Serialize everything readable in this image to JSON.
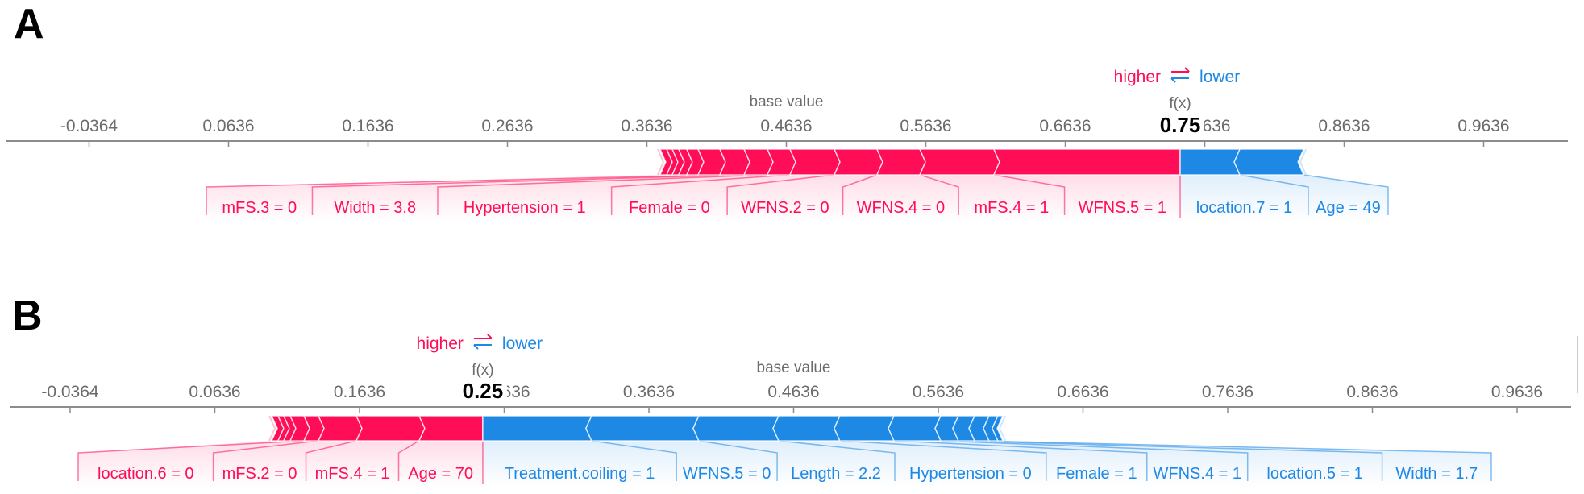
{
  "figure": {
    "colors": {
      "positive": "#ff0d57",
      "negative": "#1e88e5",
      "positive_light": "#ffc3d5",
      "negative_light": "#d1e6fa",
      "axis": "#8c8c8c",
      "text_gray": "#6b6b6b"
    }
  },
  "chart_data": [
    {
      "type": "bar",
      "subtype": "shap-force-plot",
      "panel_label": "A",
      "legend": {
        "higher": "higher",
        "lower": "lower",
        "arrow_glyph": "⇄",
        "placement": "top-right, above f(x)"
      },
      "base_value_label": "base value",
      "fx_label": "f(x)",
      "fx_value_text": "0.75",
      "fx_value": 0.746,
      "base_value": 0.4636,
      "xlim": [
        -0.085,
        1.077
      ],
      "ticks": [
        -0.0364,
        0.0636,
        0.1636,
        0.2636,
        0.3636,
        0.4636,
        0.5636,
        0.6636,
        0.7636,
        0.8636,
        0.9636
      ],
      "tick_labels": [
        "-0.0364",
        "0.0636",
        "0.1636",
        "0.2636",
        "0.3636",
        "0.4636",
        "0.5636",
        "0.6636",
        "0.7636",
        "0.8636",
        "0.9636"
      ],
      "positive_segments": [
        {
          "label": "WFNS.5 = 1",
          "start": 0.6124,
          "end": 0.746
        },
        {
          "label": "mFS.4 = 1",
          "start": 0.5593,
          "end": 0.6124
        },
        {
          "label": "WFNS.4 = 0",
          "start": 0.5286,
          "end": 0.5593
        },
        {
          "label": "WFNS.2 = 0",
          "start": 0.498,
          "end": 0.5286
        },
        {
          "label": "Female = 0",
          "start": 0.4662,
          "end": 0.498
        },
        {
          "label": "Hypertension = 1",
          "start": 0.45,
          "end": 0.4662
        },
        {
          "label": "Width = 3.8",
          "start": 0.4333,
          "end": 0.45
        },
        {
          "label": "mFS.3 = 0",
          "start": 0.4159,
          "end": 0.4333
        },
        {
          "label": "",
          "start": 0.4003,
          "end": 0.4159
        },
        {
          "label": "",
          "start": 0.3922,
          "end": 0.4003
        },
        {
          "label": "",
          "start": 0.3864,
          "end": 0.3922
        },
        {
          "label": "",
          "start": 0.3818,
          "end": 0.3864
        },
        {
          "label": "",
          "start": 0.3778,
          "end": 0.3818
        },
        {
          "label": "",
          "start": 0.3731,
          "end": 0.3778
        }
      ],
      "negative_segments": [
        {
          "label": "location.7 = 1",
          "start": 0.746,
          "end": 0.7888
        },
        {
          "label": "Age = 49",
          "start": 0.7888,
          "end": 0.8345
        }
      ]
    },
    {
      "type": "bar",
      "subtype": "shap-force-plot",
      "panel_label": "B",
      "legend": {
        "higher": "higher",
        "lower": "lower",
        "arrow_glyph": "⇄",
        "placement": "top, above f(x)"
      },
      "base_value_label": "base value",
      "fx_label": "f(x)",
      "fx_value_text": "0.25",
      "fx_value": 0.2488,
      "base_value": 0.4636,
      "xlim": [
        -0.085,
        1.0
      ],
      "ticks": [
        -0.0364,
        0.0636,
        0.1636,
        0.2636,
        0.3636,
        0.4636,
        0.5636,
        0.6636,
        0.7636,
        0.8636,
        0.9636
      ],
      "tick_labels": [
        "-0.0364",
        "0.0636",
        "0.1636",
        "0.2636",
        "0.3636",
        "0.4636",
        "0.5636",
        "0.6636",
        "0.7636",
        "0.8636",
        "0.9636"
      ],
      "positive_segments": [
        {
          "label": "Age = 70",
          "start": 0.2048,
          "end": 0.2488
        },
        {
          "label": "mFS.4 = 1",
          "start": 0.1614,
          "end": 0.2048
        },
        {
          "label": "mFS.2 = 0",
          "start": 0.1352,
          "end": 0.1614
        },
        {
          "label": "location.6 = 0",
          "start": 0.1252,
          "end": 0.1352
        },
        {
          "label": "",
          "start": 0.1157,
          "end": 0.1252
        },
        {
          "label": "",
          "start": 0.1112,
          "end": 0.1157
        },
        {
          "label": "",
          "start": 0.1073,
          "end": 0.1112
        },
        {
          "label": "",
          "start": 0.1029,
          "end": 0.1073
        }
      ],
      "negative_segments": [
        {
          "label": "Treatment.coiling = 1",
          "start": 0.2488,
          "end": 0.324
        },
        {
          "label": "WFNS.5 = 0",
          "start": 0.324,
          "end": 0.3981
        },
        {
          "label": "Length = 2.2",
          "start": 0.3981,
          "end": 0.4533
        },
        {
          "label": "Hypertension = 0",
          "start": 0.4533,
          "end": 0.4956
        },
        {
          "label": "Female = 1",
          "start": 0.4956,
          "end": 0.533
        },
        {
          "label": "WFNS.4 = 1",
          "start": 0.533,
          "end": 0.5653
        },
        {
          "label": "location.5 = 1",
          "start": 0.5653,
          "end": 0.5775
        },
        {
          "label": "Width = 1.7",
          "start": 0.5775,
          "end": 0.5887
        },
        {
          "label": "",
          "start": 0.5887,
          "end": 0.5987
        },
        {
          "label": "",
          "start": 0.5987,
          "end": 0.6048
        },
        {
          "label": "",
          "start": 0.6048,
          "end": 0.6082
        }
      ]
    }
  ]
}
